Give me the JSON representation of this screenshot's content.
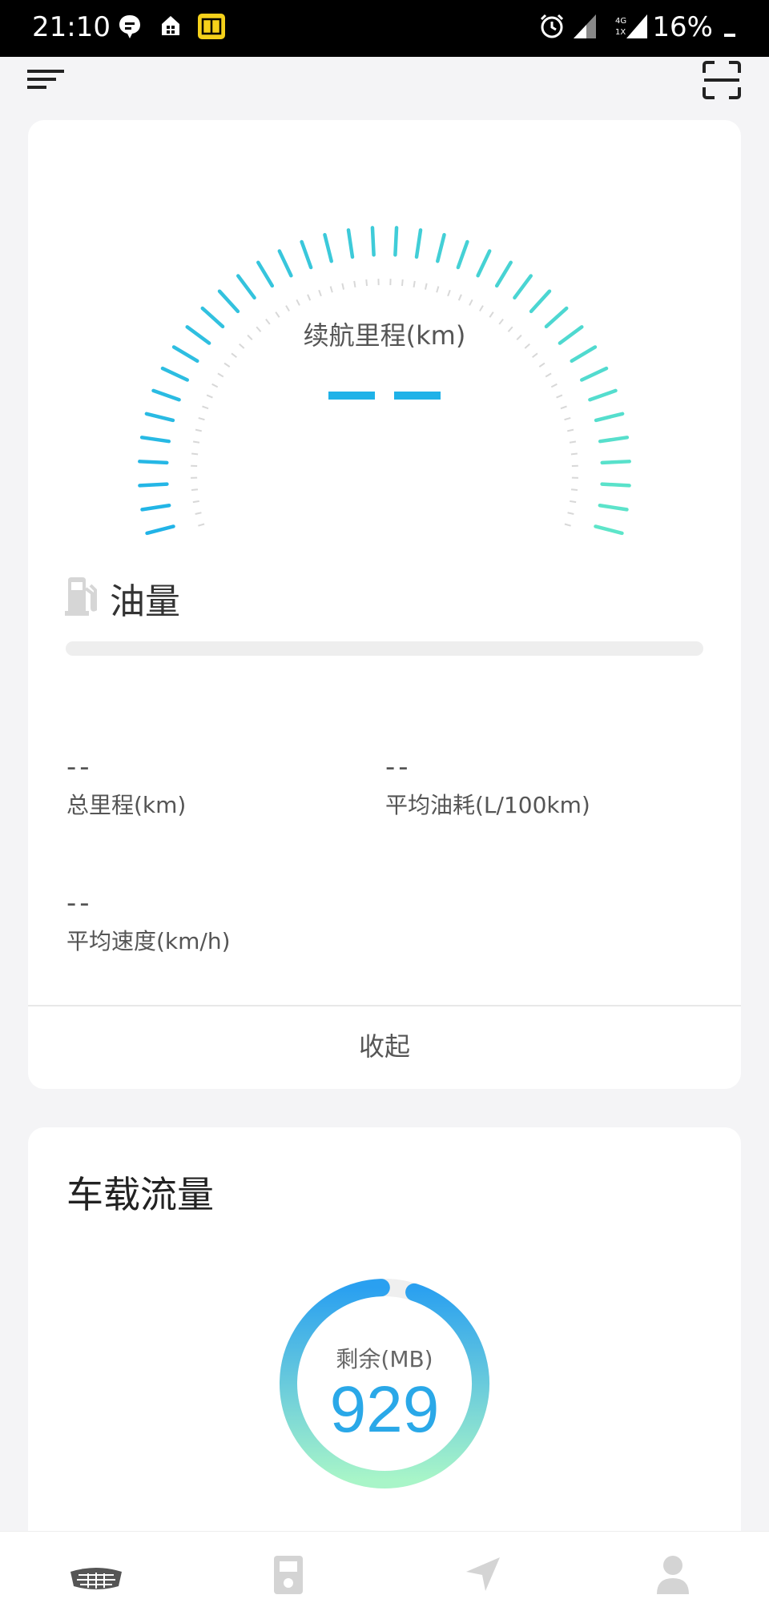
{
  "status_bar": {
    "time": "21:10",
    "battery": "16%",
    "network": [
      "4G",
      "1X"
    ],
    "icons": [
      "message-icon",
      "house-icon",
      "app-badge-icon",
      "alarm-icon",
      "signal-icon",
      "signal-icon"
    ]
  },
  "top_bar": {
    "icons": [
      "menu-icon",
      "scan-icon"
    ]
  },
  "vehicle_card": {
    "range_label": "续航里程(km)",
    "range_value": "--",
    "fuel_label": "油量",
    "fuel_level": 0,
    "stats": [
      {
        "value": "--",
        "label": "总里程(km)"
      },
      {
        "value": "--",
        "label": "平均油耗(L/100km)"
      },
      {
        "value": "--",
        "label": "平均速度(km/h)"
      }
    ],
    "collapse_label": "收起",
    "colors": {
      "gauge_start": "#1fb2e8",
      "gauge_end": "#5fe6c8"
    }
  },
  "data_card": {
    "title": "车载流量",
    "remaining_label": "剩余(MB)",
    "remaining_value": "929",
    "colors": {
      "ring_start": "#2aa0f0",
      "ring_end": "#a8f5c8",
      "value": "#2aa8e8"
    }
  },
  "bottom_nav": {
    "items": [
      {
        "icon": "car-logo-icon"
      },
      {
        "icon": "fuel-pump-icon"
      },
      {
        "icon": "navigation-icon"
      },
      {
        "icon": "user-icon"
      }
    ]
  }
}
